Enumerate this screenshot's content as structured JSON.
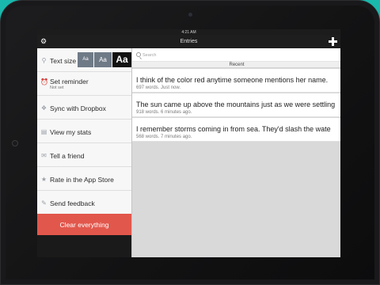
{
  "status_bar": {
    "time": "4:21 AM"
  },
  "nav": {
    "title": "Entries",
    "left_icon": "gear-icon",
    "right_icon": "plus-icon"
  },
  "sidebar": {
    "text_size": {
      "label": "Text size",
      "icon": "magnifier-icon",
      "options": [
        "Aa",
        "Aa",
        "Aa"
      ],
      "selected": 2
    },
    "items": [
      {
        "label": "Set reminder",
        "sub": "Not set",
        "icon": "alarm-clock-icon"
      },
      {
        "label": "Sync with Dropbox",
        "icon": "dropbox-icon"
      },
      {
        "label": "View my stats",
        "icon": "stats-chart-icon"
      },
      {
        "label": "Tell a friend",
        "icon": "mail-icon"
      },
      {
        "label": "Rate in the App Store",
        "icon": "star-icon"
      },
      {
        "label": "Send feedback",
        "icon": "feedback-icon"
      }
    ],
    "clear_label": "Clear everything"
  },
  "entries": {
    "search_placeholder": "Search",
    "tab_label": "Recent",
    "list": [
      {
        "text": "I think of the color red anytime someone mentions her name.",
        "meta": "697 words. Just now."
      },
      {
        "text": "The sun came up above the mountains just as we were settling",
        "meta": "918 words. 6 minutes ago."
      },
      {
        "text": "I remember storms coming in from sea.  They'd slash the wate",
        "meta": "568 words. 7 minutes ago."
      }
    ]
  },
  "colors": {
    "background": "#19b9ad",
    "clear_button": "#e2574c",
    "text_size_selected": "#111111",
    "text_size_unselected": "#6f7a87"
  }
}
